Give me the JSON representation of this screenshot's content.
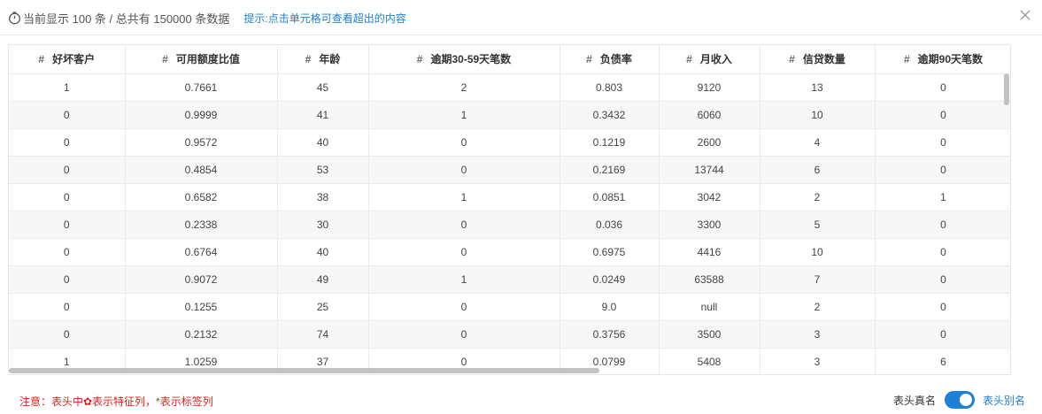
{
  "header": {
    "info_text": "当前显示 100 条 / 总共有 150000 条数据",
    "hint_text": "提示:点击单元格可查看超出的内容",
    "clock_icon": "clock-icon",
    "close_icon": "close-icon"
  },
  "table": {
    "columns": [
      {
        "hash": "#",
        "label": "好坏客户"
      },
      {
        "hash": "#",
        "label": "可用额度比值"
      },
      {
        "hash": "#",
        "label": "年龄"
      },
      {
        "hash": "#",
        "label": "逾期30-59天笔数"
      },
      {
        "hash": "#",
        "label": "负债率"
      },
      {
        "hash": "#",
        "label": "月收入"
      },
      {
        "hash": "#",
        "label": "信贷数量"
      },
      {
        "hash": "#",
        "label": "逾期90天笔数"
      }
    ],
    "rows": [
      [
        "1",
        "0.7661",
        "45",
        "2",
        "0.803",
        "9120",
        "13",
        "0"
      ],
      [
        "0",
        "0.9999",
        "41",
        "1",
        "0.3432",
        "6060",
        "10",
        "0"
      ],
      [
        "0",
        "0.9572",
        "40",
        "0",
        "0.1219",
        "2600",
        "4",
        "0"
      ],
      [
        "0",
        "0.4854",
        "53",
        "0",
        "0.2169",
        "13744",
        "6",
        "0"
      ],
      [
        "0",
        "0.6582",
        "38",
        "1",
        "0.0851",
        "3042",
        "2",
        "1"
      ],
      [
        "0",
        "0.2338",
        "30",
        "0",
        "0.036",
        "3300",
        "5",
        "0"
      ],
      [
        "0",
        "0.6764",
        "40",
        "0",
        "0.6975",
        "4416",
        "10",
        "0"
      ],
      [
        "0",
        "0.9072",
        "49",
        "1",
        "0.0249",
        "63588",
        "7",
        "0"
      ],
      [
        "0",
        "0.1255",
        "25",
        "0",
        "9.0",
        "null",
        "2",
        "0"
      ],
      [
        "0",
        "0.2132",
        "74",
        "0",
        "0.3756",
        "3500",
        "3",
        "0"
      ],
      [
        "1",
        "1.0259",
        "37",
        "0",
        "0.0799",
        "5408",
        "3",
        "6"
      ]
    ]
  },
  "footer": {
    "note_text": "注意：表头中✿表示特征列，*表示标签列",
    "toggle_left_label": "表头真名",
    "toggle_right_label": "表头别名",
    "toggle_on": true
  },
  "colors": {
    "accent": "#1e7fd6",
    "warning": "#e02020"
  }
}
